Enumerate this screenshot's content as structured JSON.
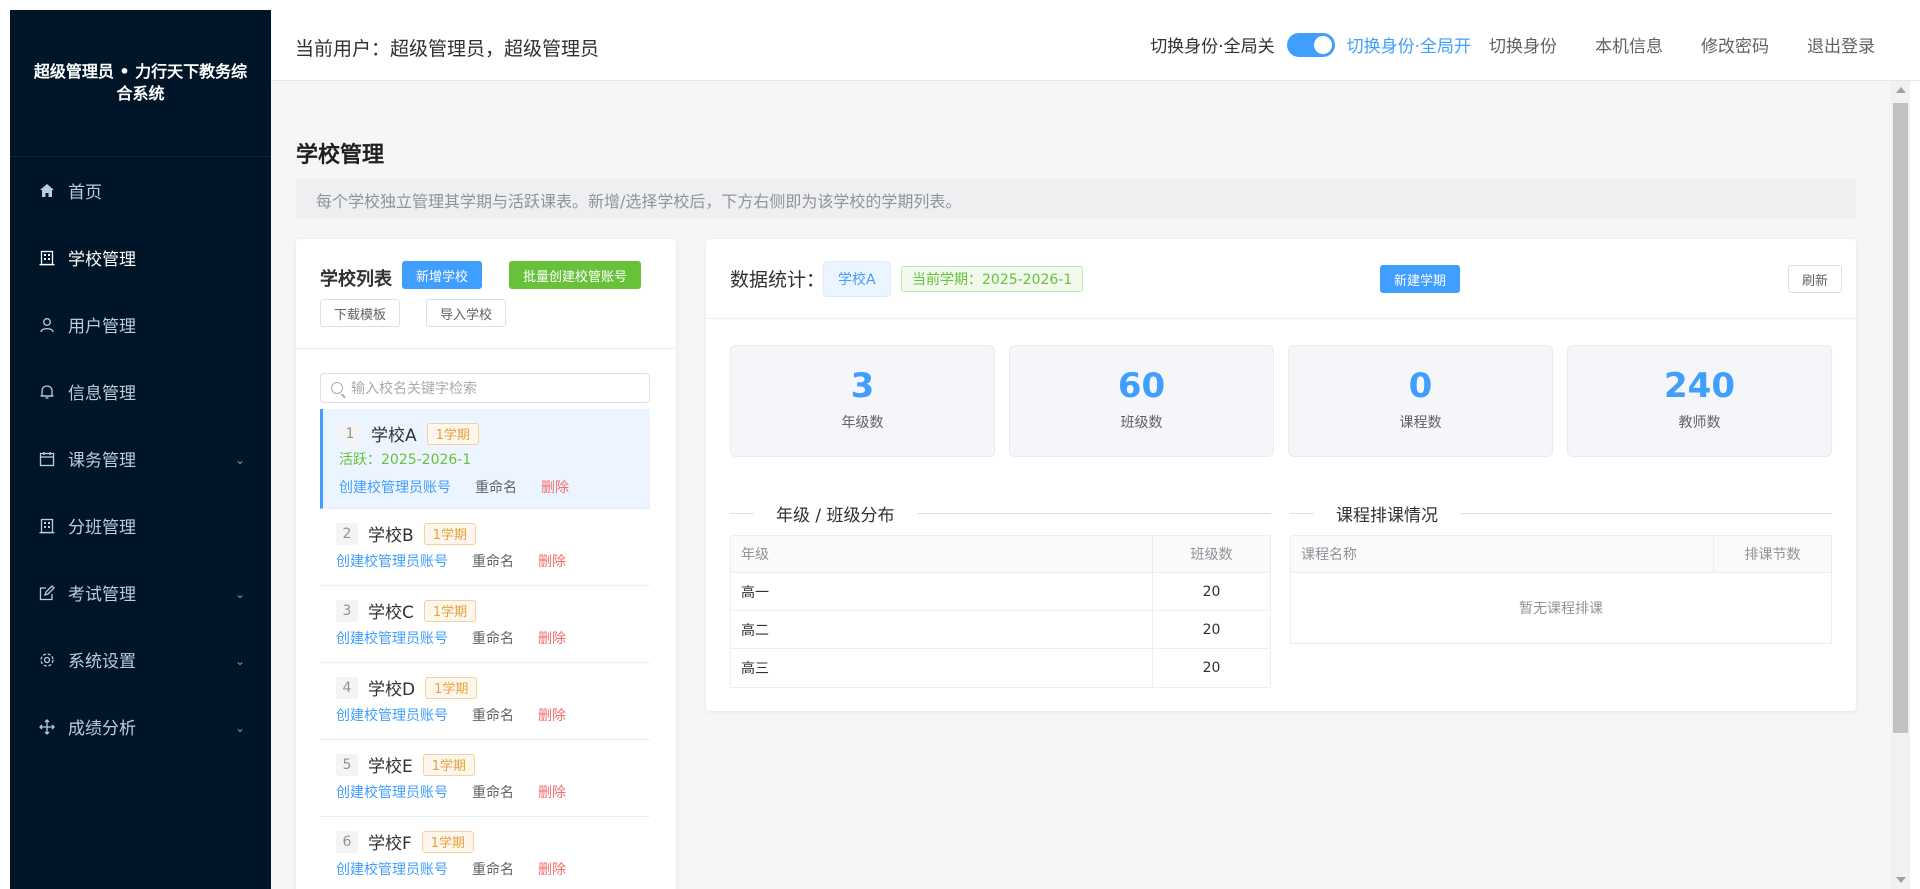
{
  "sidebar": {
    "brand": "超级管理员 • 力行天下教务综合系统",
    "items": [
      {
        "label": "首页"
      },
      {
        "label": "学校管理"
      },
      {
        "label": "用户管理"
      },
      {
        "label": "信息管理"
      },
      {
        "label": "课务管理"
      },
      {
        "label": "分班管理"
      },
      {
        "label": "考试管理"
      },
      {
        "label": "系统设置"
      },
      {
        "label": "成绩分析"
      }
    ]
  },
  "header": {
    "current_user": "当前用户：超级管理员，超级管理员",
    "toggle_off_label": "切换身份·全局关",
    "toggle_on_label": "切换身份·全局开",
    "toggle_on": true,
    "links": [
      "切换身份",
      "本机信息",
      "修改密码",
      "退出登录"
    ]
  },
  "page": {
    "title": "学校管理",
    "description": "每个学校独立管理其学期与活跃课表。新增/选择学校后，下方右侧即为该学校的学期列表。"
  },
  "school_list": {
    "title": "学校列表",
    "add_button": "新增学校",
    "batch_button": "批量创建校管账号",
    "download_button": "下载模板",
    "import_button": "导入学校",
    "search_placeholder": "输入校名关键字检索",
    "action_create": "创建校管理员账号",
    "action_rename": "重命名",
    "action_delete": "删除",
    "items": [
      {
        "num": "1",
        "name": "学校A",
        "tag": "1学期",
        "active": "活跃：2025-2026-1"
      },
      {
        "num": "2",
        "name": "学校B",
        "tag": "1学期"
      },
      {
        "num": "3",
        "name": "学校C",
        "tag": "1学期"
      },
      {
        "num": "4",
        "name": "学校D",
        "tag": "1学期"
      },
      {
        "num": "5",
        "name": "学校E",
        "tag": "1学期"
      },
      {
        "num": "6",
        "name": "学校F",
        "tag": "1学期"
      }
    ]
  },
  "stats": {
    "title": "数据统计：",
    "school_tag": "学校A",
    "term_tag": "当前学期：2025-2026-1",
    "new_term_button": "新建学期",
    "refresh_button": "刷新",
    "cards": [
      {
        "value": "3",
        "label": "年级数"
      },
      {
        "value": "60",
        "label": "班级数"
      },
      {
        "value": "0",
        "label": "课程数"
      },
      {
        "value": "240",
        "label": "教师数"
      }
    ],
    "grade_section_title": "年级 / 班级分布",
    "grade_table": {
      "headers": [
        "年级",
        "班级数"
      ],
      "rows": [
        [
          "高一",
          "20"
        ],
        [
          "高二",
          "20"
        ],
        [
          "高三",
          "20"
        ]
      ]
    },
    "course_section_title": "课程排课情况",
    "course_table": {
      "headers": [
        "课程名称",
        "排课节数"
      ],
      "empty_text": "暂无课程排课"
    }
  }
}
